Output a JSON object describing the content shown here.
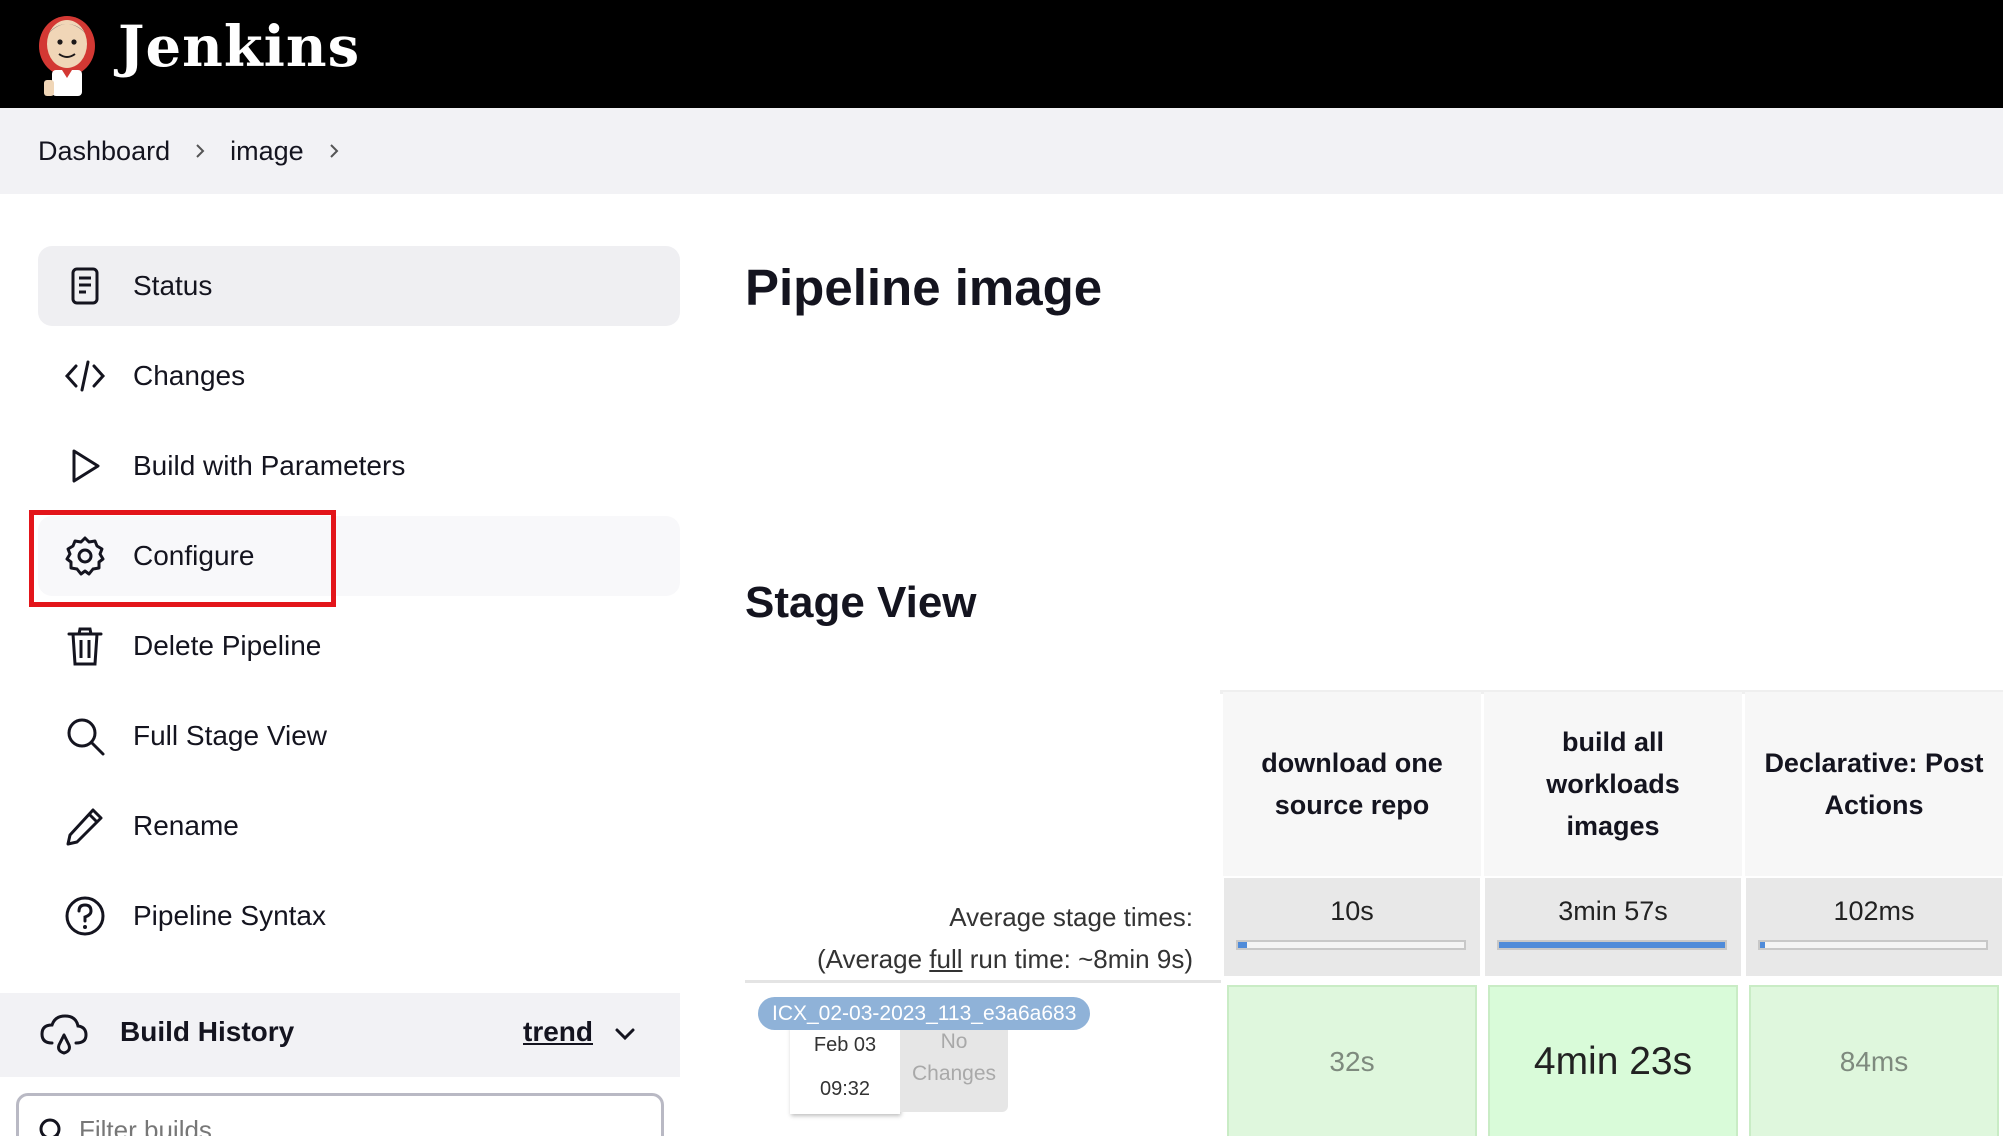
{
  "header": {
    "brand": "Jenkins"
  },
  "breadcrumb": [
    "Dashboard",
    "image"
  ],
  "sidebar": {
    "items": [
      {
        "label": "Status",
        "icon": "status-icon"
      },
      {
        "label": "Changes",
        "icon": "code-icon"
      },
      {
        "label": "Build with Parameters",
        "icon": "play-icon"
      },
      {
        "label": "Configure",
        "icon": "gear-icon"
      },
      {
        "label": "Delete Pipeline",
        "icon": "trash-icon"
      },
      {
        "label": "Full Stage View",
        "icon": "search-icon"
      },
      {
        "label": "Rename",
        "icon": "pencil-icon"
      },
      {
        "label": "Pipeline Syntax",
        "icon": "help-icon"
      }
    ],
    "active_item": "Status",
    "highlighted_item": "Configure",
    "highlight_color": "#e3151a"
  },
  "build_history": {
    "title": "Build History",
    "trend_label": "trend",
    "filter_placeholder": "Filter builds..."
  },
  "main": {
    "page_title": "Pipeline image",
    "stage_view_title": "Stage View",
    "avg_stage_label": "Average stage times:",
    "avg_run_prefix": "(Average ",
    "avg_run_link": "full",
    "avg_run_suffix": " run time: ~8min 9s)",
    "stages": [
      {
        "name": "download one source repo",
        "avg": "10s",
        "avg_fraction": 0.04
      },
      {
        "name": "build all workloads images",
        "avg": "3min 57s",
        "avg_fraction": 1.0
      },
      {
        "name": "Declarative: Post Actions",
        "avg": "102ms",
        "avg_fraction": 0.01
      }
    ],
    "build": {
      "name": "ICX_02-03-2023_113_e3a6a683",
      "date": "Feb 03",
      "time": "09:32",
      "changes": "No Changes",
      "results": [
        "32s",
        "4min 23s",
        "84ms"
      ]
    }
  },
  "colors": {
    "header_bg": "#000000",
    "success_cell": "#dff7dd",
    "progress_fill": "#4f8bd9",
    "build_badge": "#8fb2d8"
  }
}
